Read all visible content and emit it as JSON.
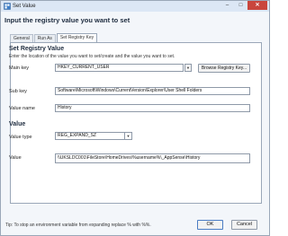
{
  "window": {
    "title": "Set Value",
    "minimize_glyph": "–",
    "maximize_glyph": "□",
    "close_glyph": "✕"
  },
  "header": {
    "title": "Input the registry value you want to set"
  },
  "tabs": [
    {
      "label": "General"
    },
    {
      "label": "Run As"
    },
    {
      "label": "Set Registry Key"
    }
  ],
  "form": {
    "section_title": "Set Registry Value",
    "description": "Enter the location of the value you want to set/create and the value you want to set.",
    "main_key_label": "Main key",
    "main_key_value": "HKEY_CURRENT_USER",
    "browse_label": "Browse Registry Key...",
    "sub_key_label": "Sub key",
    "sub_key_value": "Software\\Microsoft\\Windows\\CurrentVersion\\Explorer\\User Shell Folders",
    "value_name_label": "Value name",
    "value_name_value": "History",
    "value_section_title": "Value",
    "value_type_label": "Value type",
    "value_type_value": "REG_EXPAND_SZ",
    "value_label": "Value",
    "value_value": "\\\\UKSLDC001\\FileStore\\HomeDrives\\%username%\\_AppSense\\History"
  },
  "footer": {
    "tip": "Tip: To stop an environment variable from expanding replace % with %%.",
    "ok_label": "OK",
    "cancel_label": "Cancel"
  },
  "icons": {
    "dropdown_glyph": "▼",
    "window_icon": "registry-icon"
  }
}
